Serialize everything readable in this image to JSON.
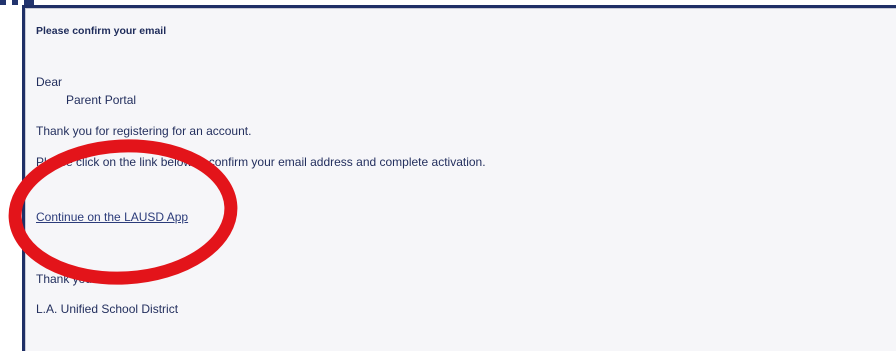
{
  "email": {
    "subject": "Please confirm your email",
    "greeting": "Dear",
    "recipient": "Parent Portal",
    "thanks_registration": "Thank you for registering for an account.",
    "instruction": "Please click on the link below to confirm your email address and complete activation.",
    "link_text": "Continue on the LAUSD App",
    "signoff": "Thank you",
    "sender": "L.A. Unified School District"
  },
  "annotation": {
    "shape": "ellipse",
    "color": "#e3141a"
  }
}
